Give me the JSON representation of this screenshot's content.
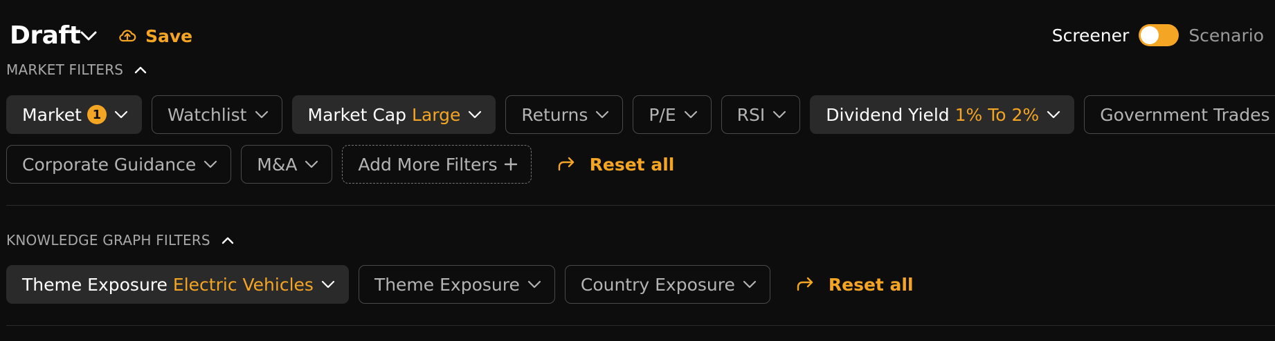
{
  "header": {
    "title": "Draft",
    "save_label": "Save",
    "mode_left": "Screener",
    "mode_right": "Scenario"
  },
  "market_filters": {
    "heading": "MARKET FILTERS",
    "chips": [
      {
        "label": "Market",
        "badge": "1"
      },
      {
        "label": "Watchlist"
      },
      {
        "label": "Market Cap",
        "value": "Large"
      },
      {
        "label": "Returns"
      },
      {
        "label": "P/E"
      },
      {
        "label": "RSI"
      },
      {
        "label": "Dividend Yield",
        "value": "1% To 2%"
      },
      {
        "label": "Government Trades"
      },
      {
        "label": "Corporate Guidance"
      },
      {
        "label": "M&A"
      }
    ],
    "add_more_label": "Add More Filters",
    "reset_label": "Reset all"
  },
  "knowledge_graph_filters": {
    "heading": "KNOWLEDGE GRAPH FILTERS",
    "chips": [
      {
        "label": "Theme Exposure",
        "value": "Electric Vehicles"
      },
      {
        "label": "Theme Exposure"
      },
      {
        "label": "Country Exposure"
      }
    ],
    "reset_label": "Reset all"
  },
  "colors": {
    "background": "#0d0d0d",
    "accent": "#f5a524",
    "chip_active": "#2a2a2a",
    "chip_border": "#4a4a4a"
  },
  "icons": {
    "title_dropdown": "chevron-down-icon",
    "save": "cloud-upload-icon",
    "section_toggle": "chevron-up-icon",
    "chip_dropdown": "chevron-down-icon",
    "add": "plus-icon",
    "reset": "share-forward-icon"
  }
}
